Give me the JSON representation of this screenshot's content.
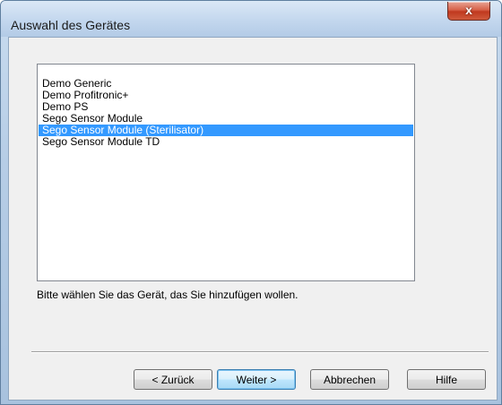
{
  "window": {
    "title": "Auswahl des Gerätes",
    "close_label": "x"
  },
  "device_list": {
    "items": [
      "Demo Generic",
      "Demo Profitronic+",
      "Demo PS",
      "Sego Sensor Module",
      "Sego Sensor Module (Sterilisator)",
      "Sego Sensor Module TD"
    ],
    "selected": "Sego Sensor Module (Sterilisator)"
  },
  "instruction": "Bitte wählen Sie das Gerät, das Sie hinzufügen wollen.",
  "buttons": {
    "back": "< Zurück",
    "next": "Weiter >",
    "cancel": "Abbrechen",
    "help": "Hilfe"
  },
  "colors": {
    "selection": "#3399ff",
    "close_button": "#c7432a"
  }
}
